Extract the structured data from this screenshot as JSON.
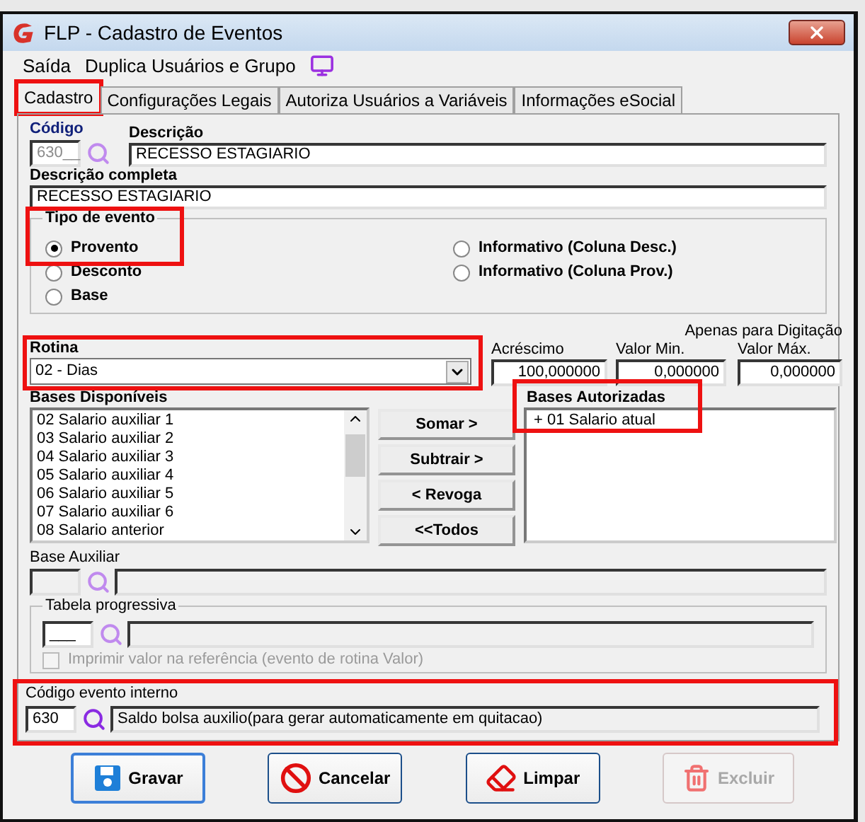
{
  "window": {
    "title": "FLP - Cadastro de Eventos"
  },
  "menu": [
    {
      "label": "Saída"
    },
    {
      "label": "Duplica Usuários e Grupo"
    }
  ],
  "tabs": [
    {
      "label": "Cadastro",
      "selected": true,
      "highlighted": true
    },
    {
      "label": "Configurações Legais",
      "selected": false,
      "highlighted": false
    },
    {
      "label": "Autoriza Usuários a Variáveis",
      "selected": false,
      "highlighted": false
    },
    {
      "label": "Informações eSocial",
      "selected": false,
      "highlighted": false
    }
  ],
  "codigo": {
    "label": "Código",
    "value": "630__"
  },
  "descricao": {
    "label": "Descrição",
    "value": "RECESSO ESTAGIARIO"
  },
  "descricao_completa": {
    "label": "Descrição completa",
    "value": "RECESSO ESTAGIARIO"
  },
  "tipo_evento": {
    "label": "Tipo de evento",
    "highlighted": true,
    "options": [
      {
        "label": "Provento",
        "selected": true
      },
      {
        "label": "Desconto",
        "selected": false
      },
      {
        "label": "Base",
        "selected": false
      },
      {
        "label": "Informativo (Coluna Desc.)",
        "selected": false
      },
      {
        "label": "Informativo (Coluna Prov.)",
        "selected": false
      }
    ]
  },
  "rotina": {
    "label": "Rotina",
    "value": "02 - Dias",
    "highlighted": true
  },
  "apenas_digitacao": "Apenas para Digitação",
  "acrescimo": {
    "label": "Acréscimo",
    "value": "100,000000"
  },
  "valor_min": {
    "label": "Valor Min.",
    "value": "0,000000"
  },
  "valor_max": {
    "label": "Valor Máx.",
    "value": "0,000000"
  },
  "bases_disponiveis": {
    "label": "Bases Disponíveis",
    "items": [
      "02 Salario auxiliar 1",
      "03 Salario auxiliar 2",
      "04 Salario auxiliar 3",
      "05 Salario auxiliar 4",
      "06 Salario auxiliar 5",
      "07 Salario auxiliar 6",
      "08 Salario anterior"
    ]
  },
  "move_buttons": [
    "Somar >",
    "Subtrair >",
    "< Revoga",
    "<<Todos"
  ],
  "bases_autorizadas": {
    "label": "Bases Autorizadas",
    "highlighted": true,
    "items": [
      "+ 01 Salario atual"
    ]
  },
  "base_auxiliar": {
    "label": "Base Auxiliar"
  },
  "tabela_progressiva": {
    "label": "Tabela progressiva",
    "code": "___",
    "checkbox": {
      "label": "Imprimir valor na referência (evento de rotina Valor)",
      "checked": false,
      "disabled": true
    }
  },
  "codigo_evento_interno": {
    "label": "Código evento interno",
    "code": "630",
    "description": "Saldo bolsa auxilio(para gerar automaticamente em quitacao)",
    "highlighted": true
  },
  "buttons": [
    {
      "label": "Gravar",
      "kind": "save",
      "disabled": false,
      "focused": true
    },
    {
      "label": "Cancelar",
      "kind": "cancel",
      "disabled": false,
      "focused": false
    },
    {
      "label": "Limpar",
      "kind": "clear",
      "disabled": false,
      "focused": false
    },
    {
      "label": "Excluir",
      "kind": "delete",
      "disabled": true,
      "focused": false
    }
  ]
}
